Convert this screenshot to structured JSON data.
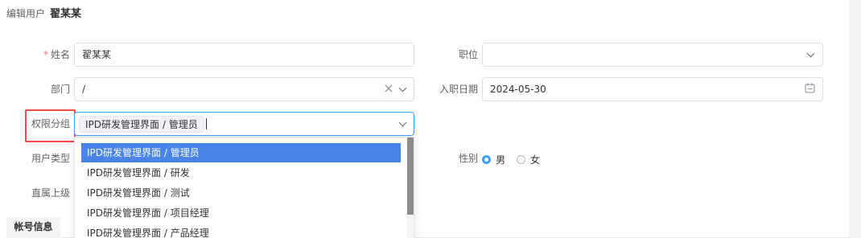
{
  "header": {
    "breadcrumb": "编辑用户",
    "title": "翟某某"
  },
  "form": {
    "name": {
      "label": "姓名",
      "required_mark": "*",
      "value": "翟某某"
    },
    "position": {
      "label": "职位",
      "value": ""
    },
    "department": {
      "label": "部门",
      "value": "/"
    },
    "join_date": {
      "label": "入职日期",
      "value": "2024-05-30"
    },
    "permission_group": {
      "label": "权限分组",
      "tag": "IPD研发管理界面 / 管理员"
    },
    "user_type": {
      "label": "用户类型"
    },
    "supervisor": {
      "label": "直属上级"
    },
    "gender": {
      "label": "性别",
      "options": [
        "男",
        "女"
      ],
      "selected": "男"
    }
  },
  "dropdown": {
    "items": [
      "IPD研发管理界面 / 管理员",
      "IPD研发管理界面 / 研发",
      "IPD研发管理界面 / 测试",
      "IPD研发管理界面 / 项目经理",
      "IPD研发管理界面 / 产品经理"
    ],
    "active_index": 0
  },
  "section": {
    "account_info": "帐号信息"
  },
  "colors": {
    "accent": "#409eff",
    "highlight_border": "#ee4b4b",
    "active_item": "#4a84e6"
  },
  "icons": [
    "chevron-down-icon",
    "clear-icon",
    "calendar-icon"
  ]
}
